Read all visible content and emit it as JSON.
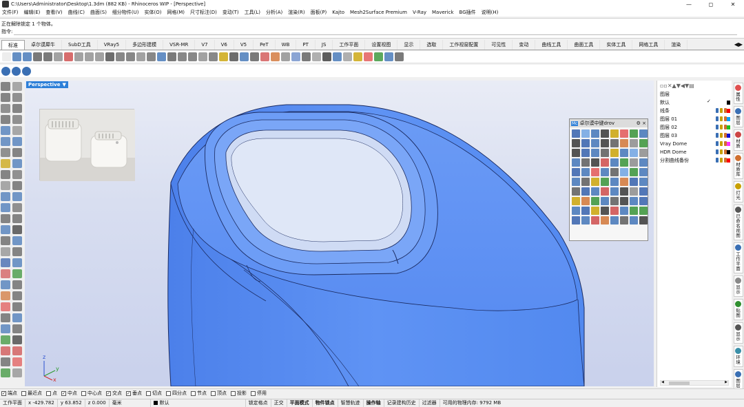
{
  "window": {
    "title": "C:\\Users\\Administrator\\Desktop\\1.3dm (882 KB) - Rhinoceros WIP - [Perspective]",
    "controls": [
      "—",
      "◻",
      "✕"
    ]
  },
  "menu": [
    "文件(F)",
    "编辑(E)",
    "查看(V)",
    "曲线(C)",
    "曲面(S)",
    "细分物件(U)",
    "实体(O)",
    "网格(M)",
    "尺寸标注(D)",
    "变动(T)",
    "工具(L)",
    "分析(A)",
    "渲染(R)",
    "面板(P)",
    "Kajto",
    "Mesh2Surface Premium",
    "V-Ray",
    "Maverick",
    "BG插件",
    "说明(H)"
  ],
  "command": {
    "history": "正在解除锁定 1 个物体。",
    "prompt": "指令:",
    "value": ""
  },
  "tabs": {
    "items": [
      "标准",
      "卓尔谟犀牛",
      "SubD工具",
      "VRay5",
      "多边形建模",
      "VSR-MR",
      "V7",
      "V6",
      "V5",
      "PeT",
      "WB",
      "PT",
      "JS",
      "工作平面",
      "设置视图",
      "显示",
      "选取",
      "工作视窗配置",
      "可见性",
      "变动",
      "曲线工具",
      "曲面工具",
      "实体工具",
      "网格工具",
      "渲染"
    ],
    "active": 0,
    "scroll_arrows": "◀▶"
  },
  "toolbar1_icon_colors": [
    "#e8e8e8",
    "#3a6fb4",
    "#3a6fb4",
    "#555",
    "#555",
    "#888",
    "#c44",
    "#888",
    "#888",
    "#888",
    "#444",
    "#666",
    "#666",
    "#888",
    "#666",
    "#3a6fb4",
    "#555",
    "#666",
    "#666",
    "#888",
    "#666",
    "#c8a000",
    "#444",
    "#3a6fb4",
    "#555",
    "#d05050",
    "#d07030",
    "#888",
    "#6a8cc8",
    "#555",
    "#999",
    "#2f2f2f",
    "#3a6fb4",
    "#999",
    "#c8a000",
    "#e05050",
    "#2f8f2f",
    "#3a6fb4",
    "#555"
  ],
  "toolbar2_icon_colors": [
    "#3a6fb4",
    "#3a6fb4",
    "#3a6fb4"
  ],
  "viewport": {
    "label": "Perspective",
    "label_arrow": "▼",
    "axes": {
      "x": "x",
      "y": "y",
      "z": "z"
    },
    "colors": {
      "model": "#5b8ff0",
      "model_dark": "#3d70d8",
      "edge": "#1a2a60",
      "bg_top": "#e9ecf6",
      "bg_bottom": "#c9d1ec"
    }
  },
  "palette": {
    "badge": "Mc",
    "title": "卓尔谟中键drov",
    "controls": "⚙ ×",
    "icon_colors": [
      "#2d5aa8",
      "#6aa0e0",
      "#3a6fb4",
      "#2f2f2f",
      "#c8a000",
      "#e05050",
      "#2f8f2f",
      "#3a6fb4",
      "#2f2f2f",
      "#2d5aa8",
      "#3a6fb4",
      "#2f2f2f",
      "#555",
      "#d07030",
      "#888",
      "#2f8f2f",
      "#2f2f2f",
      "#2d5aa8",
      "#3a6fb4",
      "#555",
      "#c8a000",
      "#3a6fb4",
      "#6aa0e0",
      "#888",
      "#3a6fb4",
      "#555",
      "#2f2f2f",
      "#c44",
      "#3a6fb4",
      "#2f8f2f",
      "#888",
      "#3a6fb4",
      "#2d5aa8",
      "#3a6fb4",
      "#e05050",
      "#3a6fb4",
      "#555",
      "#6aa0e0",
      "#2f8f2f",
      "#3a6fb4",
      "#3a6fb4",
      "#555",
      "#c8a000",
      "#2f8f2f",
      "#3a6fb4",
      "#d07030",
      "#2d5aa8",
      "#3a6fb4",
      "#555",
      "#2d5aa8",
      "#3a6fb4",
      "#c44",
      "#3a6fb4",
      "#2f2f2f",
      "#888",
      "#2d5aa8",
      "#c8a000",
      "#d07030",
      "#2f8f2f",
      "#3a6fb4",
      "#555",
      "#2f2f2f",
      "#3a6fb4",
      "#2d5aa8",
      "#3a6fb4",
      "#2d5aa8",
      "#c8a000",
      "#2f2f2f",
      "#c44",
      "#3a6fb4",
      "#2f8f2f",
      "#2f8f2f",
      "#2d5aa8",
      "#3a6fb4",
      "#c44",
      "#d07030",
      "#3a6fb4",
      "#555",
      "#3a6fb4",
      "#2f2f2f"
    ]
  },
  "layers": {
    "header": "图层",
    "tool_glyphs": "▫▫✕▲▼◀▼▤",
    "rows": [
      {
        "name": "默认",
        "current": true,
        "swatch": "#000000"
      },
      {
        "name": "线条",
        "swatch": "#ff0000"
      },
      {
        "name": "图层 01",
        "swatch": "#00a0ff"
      },
      {
        "name": "图层 02",
        "swatch": "#20c020"
      },
      {
        "name": "图层 03",
        "swatch": "#1010d0"
      },
      {
        "name": "Vray Dome",
        "swatch": "#ff30ff"
      },
      {
        "name": "HDR Dome",
        "swatch": "#000000"
      },
      {
        "name": "分割曲线备份",
        "swatch": "#ff0000"
      }
    ],
    "current_mark": "✓",
    "scroll_left": "◀",
    "scroll_right": "▶"
  },
  "side_tabs": [
    {
      "label": "属性",
      "color": "#e05050"
    },
    {
      "label": "图层",
      "color": "#3a6fb4"
    },
    {
      "label": "材质",
      "color": "#c44"
    },
    {
      "label": "材质库",
      "color": "#d07030"
    },
    {
      "label": "灯光",
      "color": "#c8a000"
    },
    {
      "label": "已命名视图",
      "color": "#555"
    },
    {
      "label": "工作平面",
      "color": "#3a6fb4"
    },
    {
      "label": "显示",
      "color": "#888"
    },
    {
      "label": "贴图",
      "color": "#2f8f2f"
    },
    {
      "label": "显示",
      "color": "#555"
    },
    {
      "label": "环境",
      "color": "#3a8fa8"
    },
    {
      "label": "图层",
      "color": "#3a6fb4"
    }
  ],
  "osnap": [
    {
      "label": "端点",
      "checked": true
    },
    {
      "label": "最近点",
      "checked": false
    },
    {
      "label": "点",
      "checked": false
    },
    {
      "label": "中点",
      "checked": true
    },
    {
      "label": "中心点",
      "checked": false
    },
    {
      "label": "交点",
      "checked": true
    },
    {
      "label": "垂点",
      "checked": true
    },
    {
      "label": "切点",
      "checked": false
    },
    {
      "label": "四分点",
      "checked": false
    },
    {
      "label": "节点",
      "checked": false
    },
    {
      "label": "顶点",
      "checked": false
    },
    {
      "label": "投影",
      "checked": false
    },
    {
      "label": "停用",
      "checked": false
    }
  ],
  "status": {
    "cplane": "工作平面",
    "x": "x -429.782",
    "y": "y 63.852",
    "z": "z 0.000",
    "units": "毫米",
    "layer": "默认",
    "snap_grid": "锁定格点",
    "ortho": "正交",
    "planar": "平面模式",
    "osnap": "物件锁点",
    "smarttrack": "智慧轨迹",
    "gumball": "操作轴",
    "history": "记录建构历史",
    "filter": "过滤器",
    "memory": "可用的物理内存: 9792 MB"
  }
}
